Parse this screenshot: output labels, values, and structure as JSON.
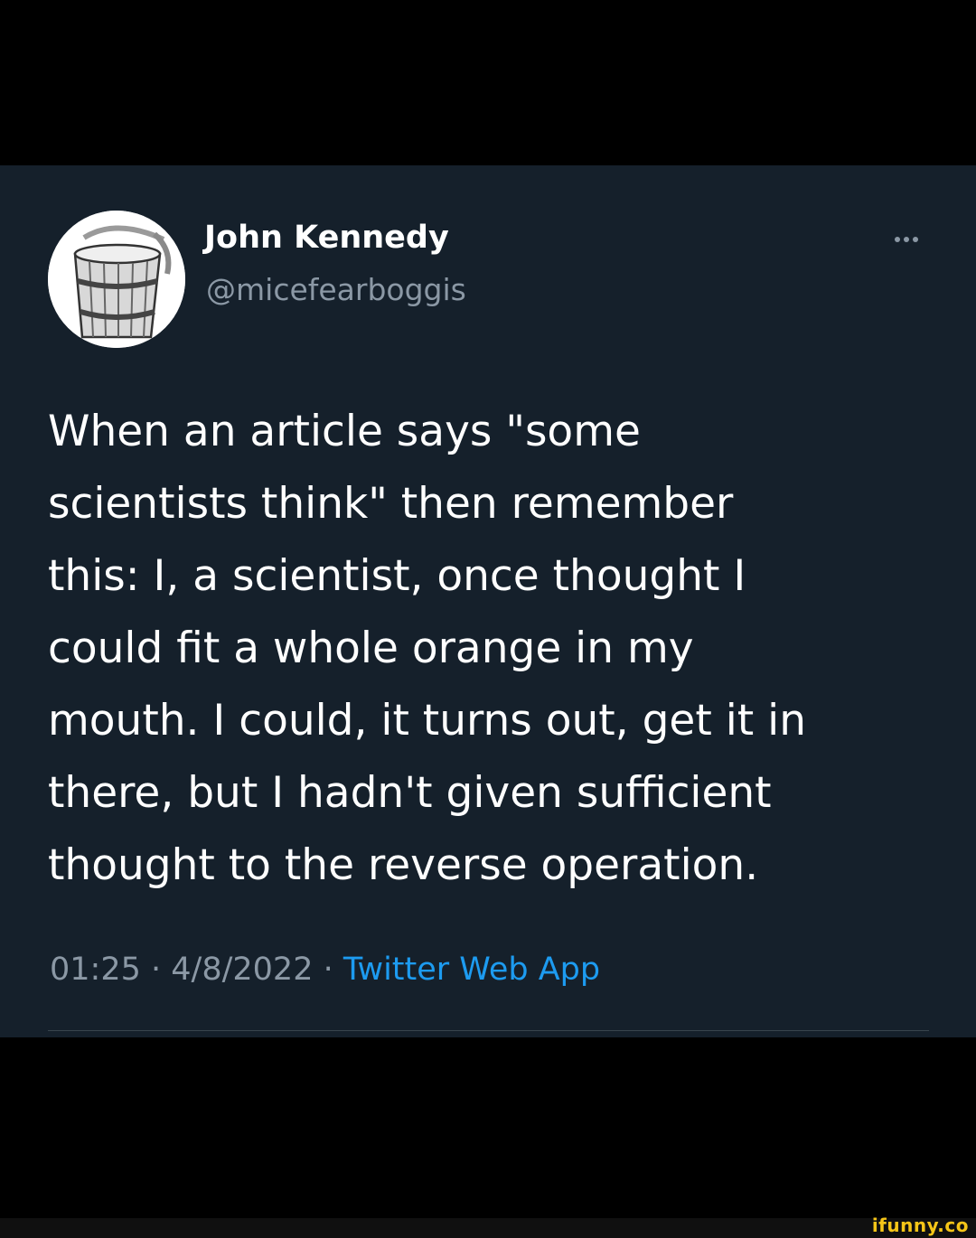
{
  "tweet": {
    "author": {
      "display_name": "John Kennedy",
      "handle": "@micefearboggis",
      "avatar_icon": "wooden-bucket-icon"
    },
    "more_icon": "more-dots-icon",
    "text": "When an article says \"some\nscientists think\" then remember\nthis: I, a scientist, once thought I\ncould fit a whole orange in my\nmouth. I could, it turns out, get it in\nthere, but I hadn't given sufficient\nthought to the reverse operation.",
    "time": "01:25",
    "separator": " · ",
    "date": "4/8/2022",
    "source": "Twitter Web App"
  },
  "watermark": "ifunny.co",
  "colors": {
    "page_background": "#000000",
    "card_background": "#15202b",
    "primary_text": "#ffffff",
    "secondary_text": "#8b98a5",
    "link": "#1d9bf0",
    "watermark": "#f5c518"
  }
}
